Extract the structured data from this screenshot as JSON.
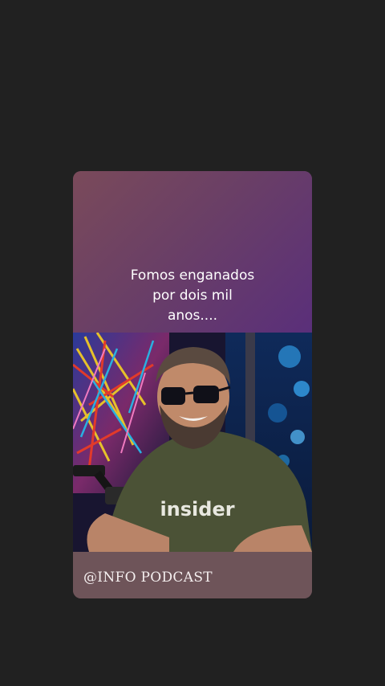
{
  "story": {
    "caption_lines": [
      "Fomos enganados",
      "por dois mil",
      "anos...."
    ],
    "footer_label": "@INFO PODCAST",
    "shirt_logo": "insider"
  },
  "colors": {
    "background": "#212121",
    "caption_gradient_start": "#7a4a5a",
    "caption_gradient_end": "#5a2f7a",
    "footer_bar": "#6e5459",
    "shirt": "#4b5236"
  }
}
